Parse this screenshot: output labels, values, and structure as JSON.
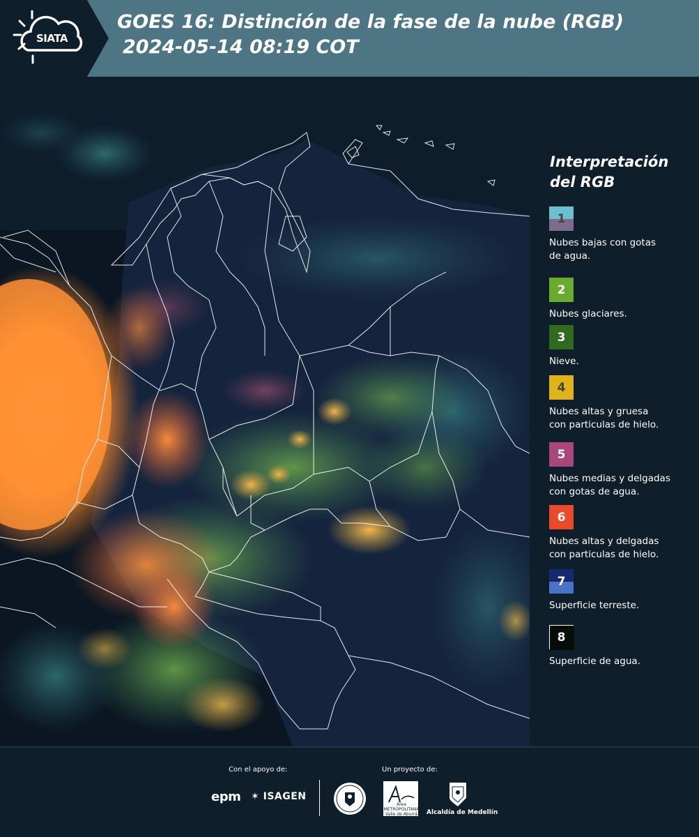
{
  "header": {
    "logo_text": "SIATA",
    "title_line1": "GOES 16: Distinción de la fase de la nube (RGB)",
    "title_line2": "2024-05-14 08:19 COT",
    "background_color": "#4e7584"
  },
  "map": {
    "image_type": "RGB cloud phase satellite composite",
    "colors": {
      "ocean": "#0b1622",
      "land": "#16253e",
      "deep_convection": "#ff8a2a",
      "mixed": "#6ea84a",
      "borders": "#ffffff"
    }
  },
  "legend": {
    "title": "Interpretación del RGB",
    "items": [
      {
        "number": "1",
        "label": "Nubes bajas con gotas\nde agua.",
        "color_top": "#6dbfcf",
        "color_bottom": "#7c6b8a",
        "num_color": "#444444"
      },
      {
        "number": "2",
        "label": "Nubes glaciares.",
        "color_top": "#6aaa2f",
        "color_bottom": "#6aaa2f",
        "num_color": "#ffffff"
      },
      {
        "number": "3",
        "label": "Nieve.",
        "color_top": "#2f6a1e",
        "color_bottom": "#2f6a1e",
        "num_color": "#ffffff"
      },
      {
        "number": "4",
        "label": "Nubes altas y gruesa\ncon particulas de hielo.",
        "color_top": "#e0b21c",
        "color_bottom": "#e0b21c",
        "num_color": "#444444"
      },
      {
        "number": "5",
        "label": "Nubes medias y delgadas\ncon gotas de agua.",
        "color_top": "#a8467e",
        "color_bottom": "#a8467e",
        "num_color": "#ffffff"
      },
      {
        "number": "6",
        "label": "Nubes altas y delgadas\ncon particulas de hielo.",
        "color_top": "#e84a2a",
        "color_bottom": "#e84a2a",
        "num_color": "#ffffff"
      },
      {
        "number": "7",
        "label": "Superficie terreste.",
        "color_top": "#15296e",
        "color_bottom": "#4a73c8",
        "num_color": "#ffffff"
      },
      {
        "number": "8",
        "label": "Superficie de agua.",
        "color_top": "#060c08",
        "color_bottom": "#060c08",
        "num_color": "#ffffff",
        "border": "#ffffff"
      }
    ]
  },
  "footer": {
    "support_label": "Con el apoyo de:",
    "project_label": "Un proyecto de:",
    "sponsor_1": "epm",
    "sponsor_2": "ISAGEN",
    "partner_area_name": "Área\nMETROPOLITANA\nValle de Aburrá",
    "partner_alcaldia": "Alcaldía de Medellín"
  }
}
